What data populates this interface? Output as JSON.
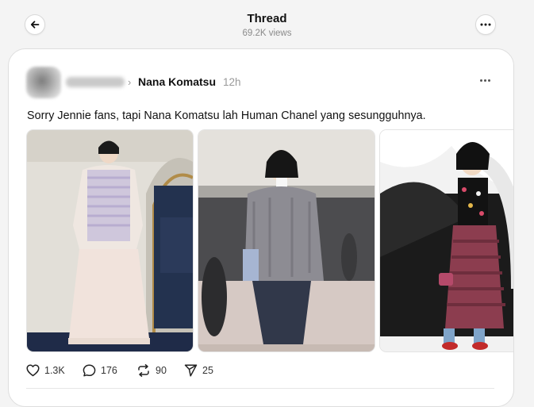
{
  "header": {
    "title": "Thread",
    "views": "69.2K views",
    "back_icon": "arrow-left-icon",
    "more_icon": "more-horizontal-icon"
  },
  "post": {
    "author": "Nana Komatsu",
    "time": "12h",
    "text": "Sorry Jennie fans, tapi Nana Komatsu lah Human Chanel yang sesungguhnya.",
    "images": [
      {
        "icon": "photo-cream-tweed-gown"
      },
      {
        "icon": "photo-grey-tweed-jacket"
      },
      {
        "icon": "photo-tweed-skirt-outfit"
      }
    ],
    "actions": {
      "likes": "1.3K",
      "comments": "176",
      "reposts": "90",
      "shares": "25"
    }
  },
  "colors": {
    "background": "#f4f4f4",
    "card": "#ffffff",
    "text": "#101010",
    "muted": "#999999"
  }
}
